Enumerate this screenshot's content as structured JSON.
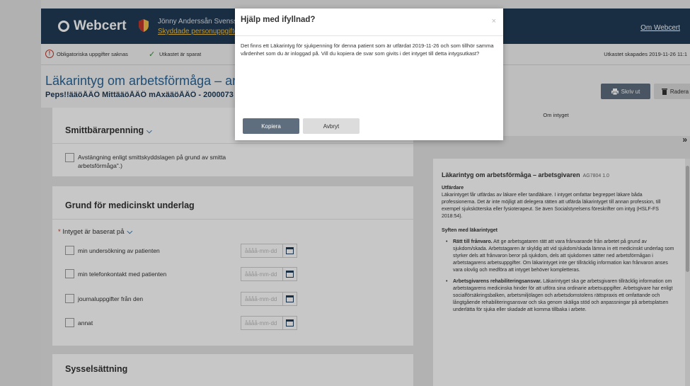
{
  "header": {
    "logo_text": "Webcert",
    "user_name": "Jönny Anderssån Svenssån",
    "protected_link": "Skyddade personuppgifter",
    "about_link": "Om Webcert",
    "bg_color": "#213b57"
  },
  "statusbar": {
    "required_warning": "Obligatoriska uppgifter saknas",
    "saved_text": "Utkastet är sparat",
    "created_text": "Utkastet skapades 2019-11-26 11:1"
  },
  "document": {
    "title": "Läkarintyg om arbetsförmåga – arbets",
    "patient": "Peps!!ääöÅÄÖ MittääöÅÄÖ mAxääöÅÄÖ - 2000073",
    "print_button": "Skriv ut",
    "delete_button": "Radera"
  },
  "form": {
    "smitt": {
      "title": "Smittbärarpenning",
      "checkbox_label_line1": "Avstängning enligt smittskyddslagen på grund av smitta",
      "checkbox_label_line2": "arbetsförmåga\".)"
    },
    "grund": {
      "title": "Grund för medicinskt underlag",
      "required_mark": "*",
      "basis_label": "Intyget är baserat på",
      "date_placeholder": "åååå-mm-dd",
      "options": [
        "min undersökning av patienten",
        "min telefonkontakt med patienten",
        "journaluppgifter från den",
        "annat"
      ]
    },
    "syssel": {
      "title": "Sysselsättning"
    }
  },
  "info": {
    "header_title": "Om intyget",
    "collapse_icon": "»",
    "heading": "Läkarintyg om arbetsförmåga – arbetsgivaren",
    "code": "AG7804 1.0",
    "issuer_heading": "Utfärdare",
    "issuer_text": "Läkarintyget får utfärdas av läkare eller tandläkare. I intyget omfattar begreppet läkare båda professionerna. Det är inte möjligt att delegera rätten att utfärda läkarintyget till annan profession, till exempel sjuksköterska eller fysioterapeut. Se även Socialstyrelsens föreskrifter om intyg (HSLF-FS 2018:54).",
    "purpose_heading": "Syften med läkarintyget",
    "bullet1_bold": "Rätt till frånvaro.",
    "bullet1_text": " Att ge arbetsgataren rätt att vara frånvarande från arbetet på grund av sjukdom/skada. Arbetstagaren är skyldig att vid sjukdom/skada lämna in ett medicinskt underlag som styrker dels att frånvaron beror på sjukdom, dels att sjukdomen sätter ned arbetsförmågan i arbetstagarens arbetsuppgifter. Om läkarintyget inte ger tillräcklig information kan frånvaron anses vara olovlig och medföra att intyget behöver kompletteras.",
    "bullet2_bold": "Arbetsgivarens rehabiliteringsansvar.",
    "bullet2_text": " Läkarintyget ska ge arbetsgivaren tillräcklig information om arbetstagarens medicinska hinder för att utföra sina ordinarie arbetsuppgifter. Arbetsgivare har enligt socialförsäkringsbalken, arbetsmiljölagen och arbetsdomstolens rättspraxis ett omfattande och långtgående rehabiliteringsansvar och ska genom skäliga stöd och anpassningar på arbetsplatsen underlätta för sjuka eller skadade att komma tillbaka i arbete."
  },
  "modal": {
    "title": "Hjälp med ifyllnad?",
    "close": "×",
    "body": "Det finns ett Läkarintyg för sjukpenning för denna patient som är utfärdat 2019-11-26 och som tillhör samma vårdenhet som du är inloggad på. Vill du kopiera de svar som givits i det intyget till detta intygsutkast?",
    "copy_button": "Kopiera",
    "cancel_button": "Avbryt"
  }
}
